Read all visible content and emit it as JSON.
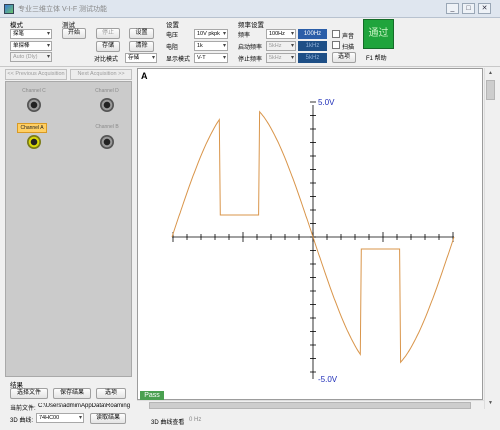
{
  "window": {
    "title": "专业三维立体 V-I-F 测试功能",
    "buttons": [
      "_",
      "□",
      "✕"
    ]
  },
  "mode": {
    "group_label": "模式",
    "mode_select": "探笔",
    "step_select": "单探棒",
    "auto_select": "Auto (Dly)"
  },
  "test": {
    "group_label": "测试",
    "start": "开始",
    "stop": "停止",
    "settings": "设置",
    "save": "存储",
    "clear": "清除",
    "compare_mode_label": "对比模式",
    "compare_mode_value": "存储"
  },
  "settings": {
    "group_label": "设置",
    "voltage_label": "电压",
    "voltage_value": "10V pkpk",
    "resistor_label": "电阻",
    "resistor_value": "1k",
    "display_label": "显示模式",
    "display_value": "V-T"
  },
  "frequency": {
    "group_label": "频率设置",
    "freq_label": "频率",
    "freq_value": "100Hz",
    "freq_display": "100Hz",
    "start_label": "启动频率",
    "start_value": "5kHz",
    "start_display": "1kHz",
    "stop_label": "停止频率",
    "stop_value": "5kHz",
    "stop_display": "5kHz",
    "sound_label": "声音",
    "scan_label": "扫描",
    "options_label": "选项"
  },
  "status_pass_big": "通过",
  "help_label": "F1 帮助",
  "acquisition": {
    "prev": "<< Previous Acquisition",
    "next": "Next Acquisition >>"
  },
  "channels": {
    "c": "Channel C",
    "d": "Channel D",
    "a": "Channel A",
    "b": "Channel B"
  },
  "results": {
    "group_label": "结果",
    "select_file": "选择文件",
    "save_result": "保存结果",
    "options": "选项",
    "current_file_label": "当前文件:",
    "current_file_value": "C:\\Users\\admin\\AppData\\Roaming\\Micr",
    "curve_3d_label": "3D 曲线:",
    "curve_3d_value": "74HC00",
    "read_result": "读取结果"
  },
  "scope": {
    "letter": "A",
    "vmax": "5.0V",
    "vmin": "-5.0V",
    "pass_badge": "Pass"
  },
  "statusbar": {
    "curve_view_label": "3D 曲线查看",
    "curve_view_value": "0 Hz"
  },
  "colors": {
    "trace": "#d9954a",
    "axis": "#000000",
    "voltage_label": "#1e2db8",
    "pass_green": "#1fa43c",
    "freq_box": "#2b5ea8"
  }
}
